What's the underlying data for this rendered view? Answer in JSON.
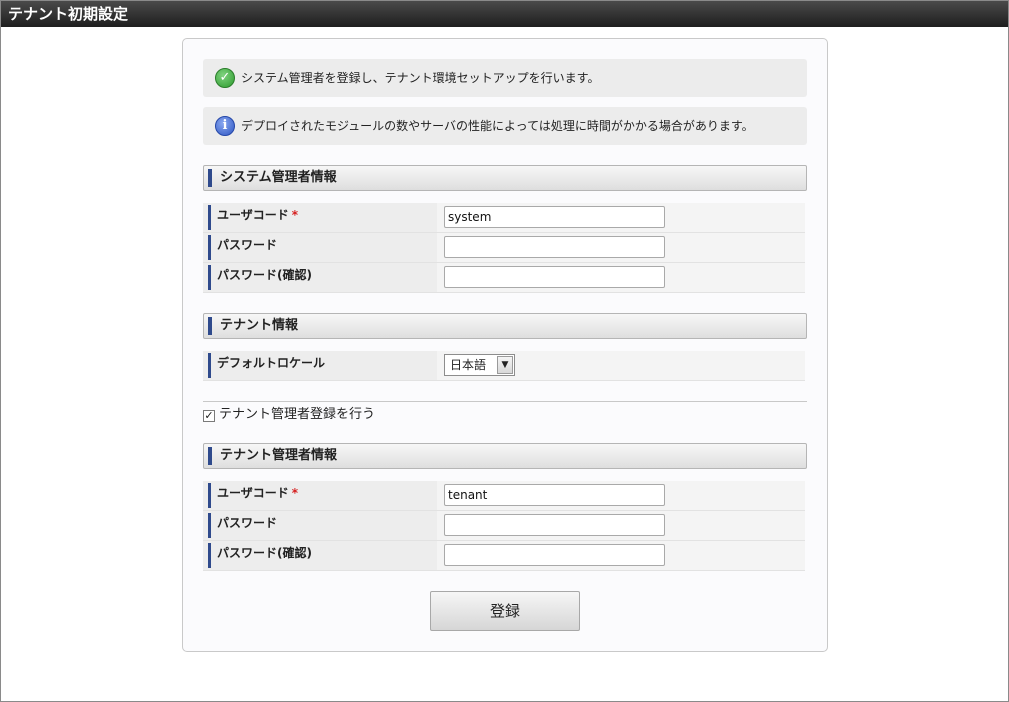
{
  "window": {
    "title": "テナント初期設定"
  },
  "messages": [
    {
      "icon": "check-circle-icon",
      "text": "システム管理者を登録し、テナント環境セットアップを行います。"
    },
    {
      "icon": "info-circle-icon",
      "text": "デプロイされたモジュールの数やサーバの性能によっては処理に時間がかかる場合があります。"
    }
  ],
  "system_admin": {
    "header": "システム管理者情報",
    "user_code_label": "ユーザコード",
    "user_code_value": "system",
    "password_label": "パスワード",
    "password_confirm_label": "パスワード(確認)"
  },
  "tenant": {
    "header": "テナント情報",
    "locale_label": "デフォルトロケール",
    "locale_value": "日本語"
  },
  "register_tenant_admin": {
    "label": "テナント管理者登録を行う",
    "checked": true
  },
  "tenant_admin": {
    "header": "テナント管理者情報",
    "user_code_label": "ユーザコード",
    "user_code_value": "tenant",
    "password_label": "パスワード",
    "password_confirm_label": "パスワード(確認)"
  },
  "required_mark": "*",
  "submit_label": "登録",
  "colors": {
    "accent_bar": "#2f4a8c",
    "required": "#d62020",
    "titlebar": "#2a2a2a"
  }
}
